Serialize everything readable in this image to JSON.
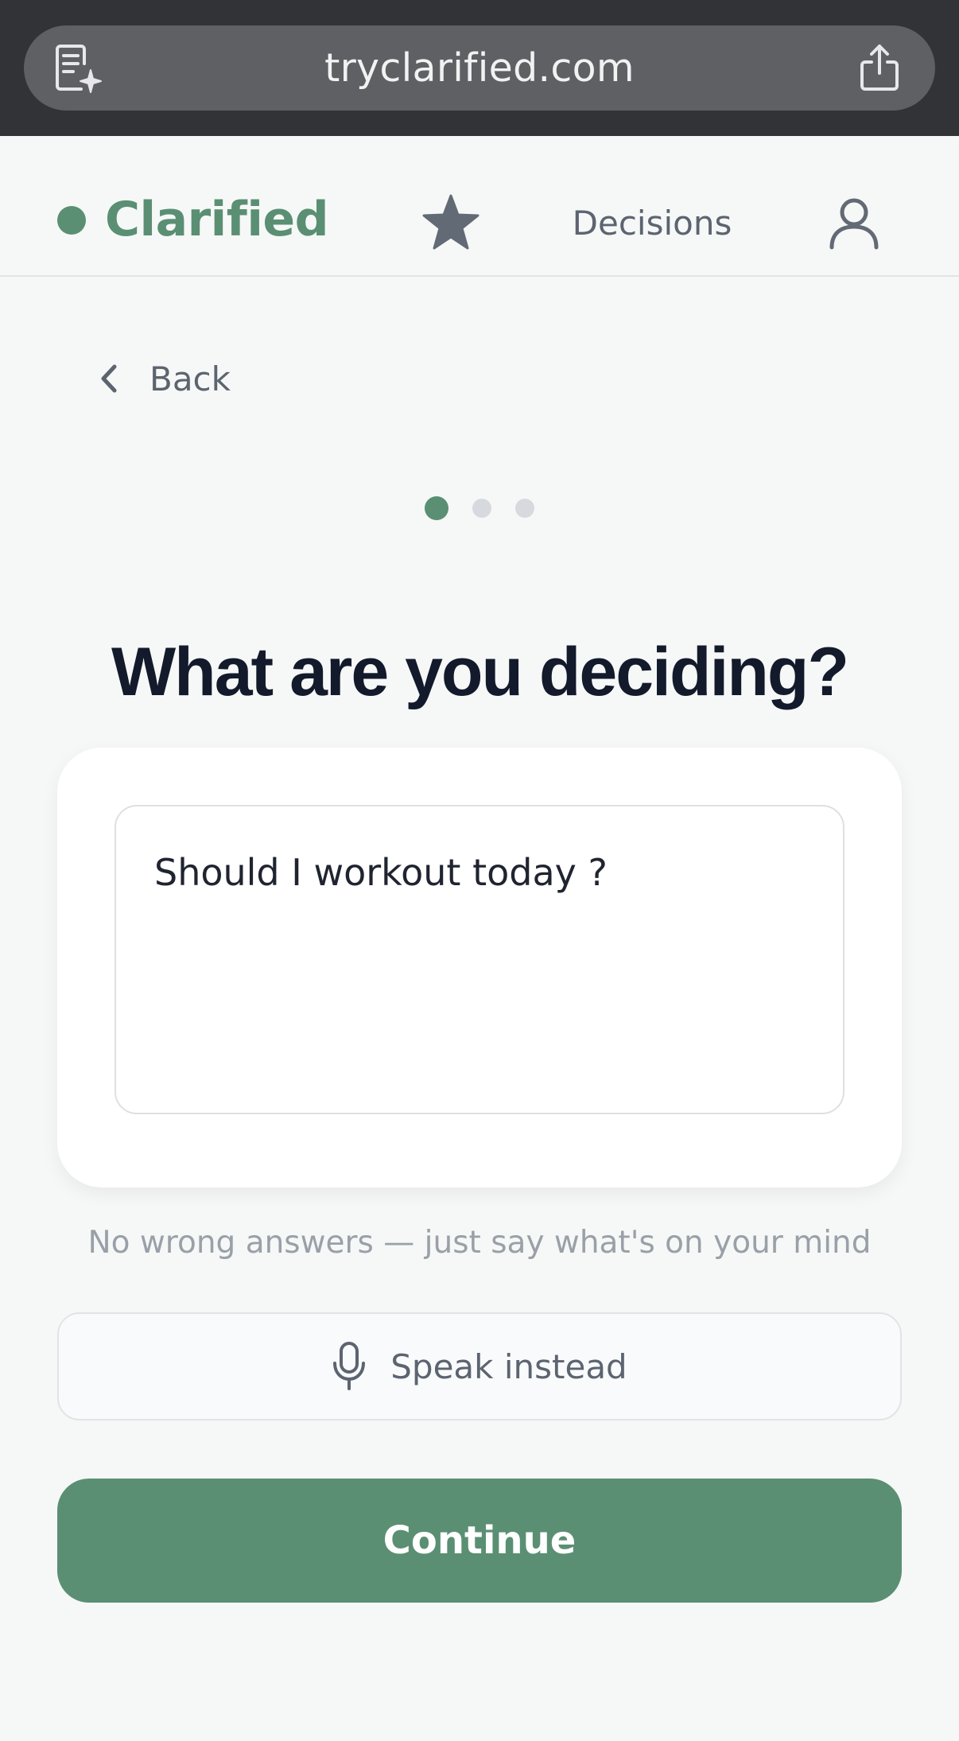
{
  "browser": {
    "url": "tryclarified.com",
    "icons": {
      "reader": "reader-mode-icon",
      "share": "share-icon"
    }
  },
  "header": {
    "brand": "Clarified",
    "nav_decisions": "Decisions",
    "icons": {
      "favorites": "star-icon",
      "profile": "user-icon"
    }
  },
  "back": {
    "label": "Back",
    "icon": "chevron-left-icon"
  },
  "steps": {
    "current": 1,
    "total": 3
  },
  "question": {
    "title": "What are you deciding?",
    "answer_value": "Should I workout today ?",
    "helper": "No wrong answers — just say what's on your mind"
  },
  "actions": {
    "speak_label": "Speak instead",
    "speak_icon": "microphone-icon",
    "continue_label": "Continue"
  },
  "colors": {
    "brand": "#5a8f73",
    "heading": "#131a2b",
    "muted": "#5c6470",
    "helper": "#9aa0a8",
    "browser_bar": "#323336"
  }
}
